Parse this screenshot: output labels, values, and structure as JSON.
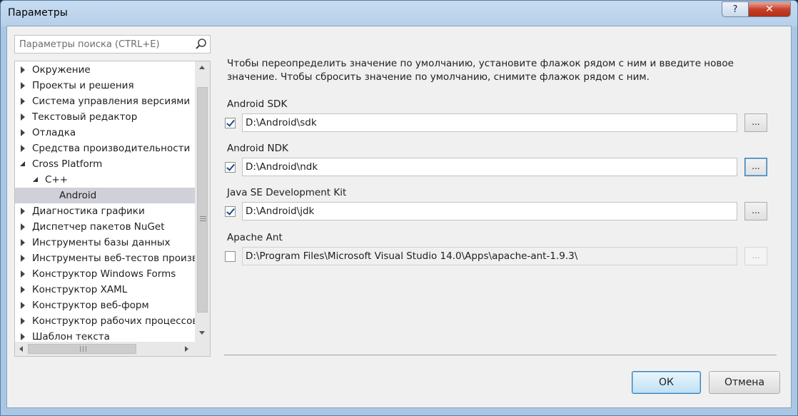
{
  "window": {
    "title": "Параметры",
    "help_glyph": "?",
    "close_glyph": "✕"
  },
  "search": {
    "placeholder": "Параметры поиска (CTRL+E)"
  },
  "tree": {
    "items": [
      {
        "label": "Окружение",
        "state": "collapsed",
        "level": 0
      },
      {
        "label": "Проекты и решения",
        "state": "collapsed",
        "level": 0
      },
      {
        "label": "Система управления версиями",
        "state": "collapsed",
        "level": 0
      },
      {
        "label": "Текстовый редактор",
        "state": "collapsed",
        "level": 0
      },
      {
        "label": "Отладка",
        "state": "collapsed",
        "level": 0
      },
      {
        "label": "Средства производительности",
        "state": "collapsed",
        "level": 0
      },
      {
        "label": "Cross Platform",
        "state": "expanded",
        "level": 0
      },
      {
        "label": "C++",
        "state": "expanded",
        "level": 1
      },
      {
        "label": "Android",
        "state": "leaf",
        "level": 2,
        "selected": true
      },
      {
        "label": "Диагностика графики",
        "state": "collapsed",
        "level": 0
      },
      {
        "label": "Диспетчер пакетов NuGet",
        "state": "collapsed",
        "level": 0
      },
      {
        "label": "Инструменты базы данных",
        "state": "collapsed",
        "level": 0
      },
      {
        "label": "Инструменты веб-тестов произв",
        "state": "collapsed",
        "level": 0
      },
      {
        "label": "Конструктор Windows Forms",
        "state": "collapsed",
        "level": 0
      },
      {
        "label": "Конструктор XAML",
        "state": "collapsed",
        "level": 0
      },
      {
        "label": "Конструктор веб-форм",
        "state": "collapsed",
        "level": 0
      },
      {
        "label": "Конструктор рабочих процессов",
        "state": "collapsed",
        "level": 0
      },
      {
        "label": "Шаблон текста",
        "state": "collapsed",
        "level": 0
      }
    ]
  },
  "panel": {
    "description": "Чтобы переопределить значение по умолчанию, установите флажок рядом с ним и введите новое значение. Чтобы сбросить значение по умолчанию, снимите флажок рядом с ним.",
    "fields": [
      {
        "label": "Android SDK",
        "checked": true,
        "value": "D:\\Android\\sdk",
        "browse": "...",
        "enabled": true
      },
      {
        "label": "Android NDK",
        "checked": true,
        "value": "D:\\Android\\ndk",
        "browse": "...",
        "enabled": true,
        "focused": true
      },
      {
        "label": "Java SE Development Kit",
        "checked": true,
        "value": "D:\\Android\\jdk",
        "browse": "...",
        "enabled": true
      },
      {
        "label": "Apache Ant",
        "checked": false,
        "value": "D:\\Program Files\\Microsoft Visual Studio 14.0\\Apps\\apache-ant-1.9.3\\",
        "browse": "...",
        "enabled": false
      }
    ]
  },
  "buttons": {
    "ok": "ОК",
    "cancel": "Отмена"
  },
  "colors": {
    "title_gradient_top": "#c7dcf1",
    "close_red": "#c7412a",
    "selection": "#d0d0d8",
    "focus_blue": "#3c7fb1"
  }
}
